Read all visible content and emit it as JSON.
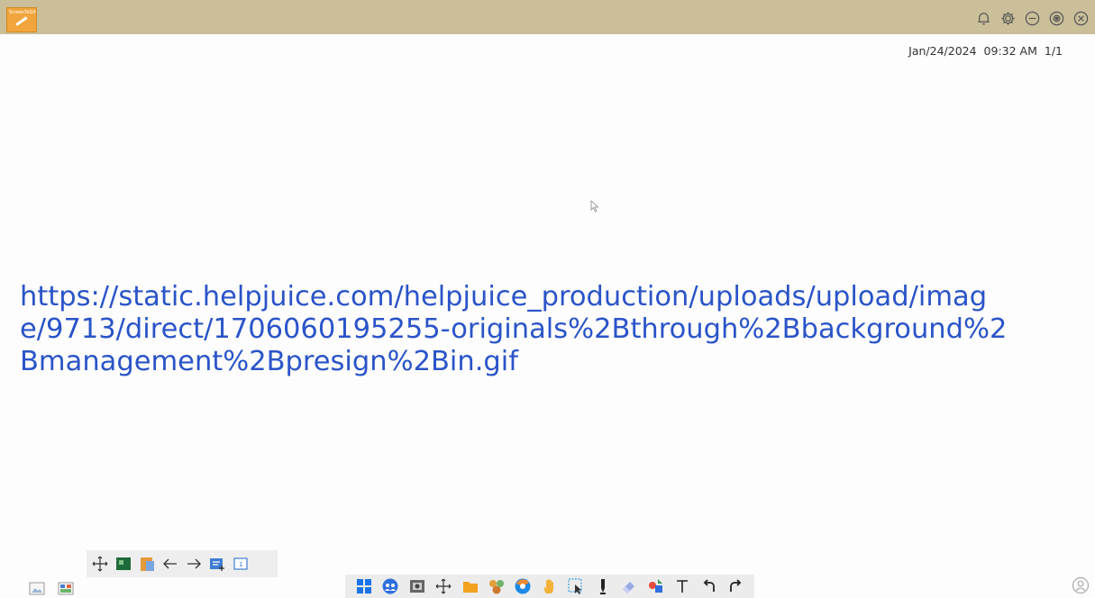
{
  "titlebar": {
    "logo_text": "ScreenToGif",
    "icons": [
      "bell-icon",
      "gear-icon",
      "minimize-icon",
      "restore-icon",
      "close-icon"
    ]
  },
  "status": {
    "date": "Jan/24/2024",
    "time": "09:32 AM",
    "page": "1/1"
  },
  "content": {
    "url": "https://static.helpjuice.com/helpjuice_production/uploads/upload/image/9713/direct/1706060195255-originals%2Bthrough%2Bbackground%2Bmanagement%2Bpresign%2Bin.gif"
  },
  "page_toolbar": [
    "move-icon",
    "background-icon",
    "clipboard-icon",
    "arrow-left-icon",
    "arrow-right-icon",
    "add-page-icon",
    "page-number-icon"
  ],
  "main_toolbar": [
    "windows-icon",
    "people-icon",
    "screenshot-icon",
    "move-icon",
    "folder-icon",
    "plugins-icon",
    "browser-icon",
    "hand-icon",
    "select-icon",
    "pen-icon",
    "eraser-icon",
    "shape-icon",
    "text-icon",
    "undo-icon",
    "redo-icon"
  ],
  "colors": {
    "titlebar": "#cbbf9a",
    "url_text": "#2a54c8",
    "accent": "#f1a53c"
  }
}
